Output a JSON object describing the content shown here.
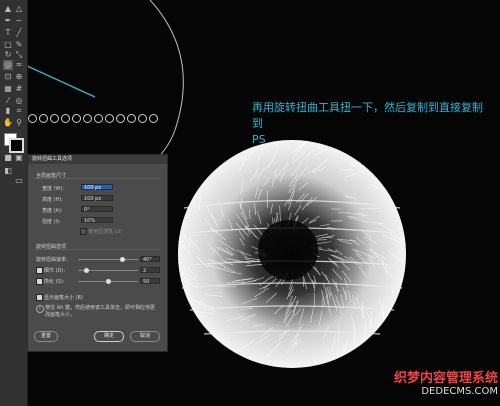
{
  "instruction": {
    "line1": "再用旋转扭曲工具扭一下，然后复制到直接复制到",
    "line2": "PS"
  },
  "dialog": {
    "title": "旋转扭曲工具选项",
    "section_brush": "全局画笔尺寸",
    "width_label": "宽度 (W):",
    "width_value": "100 px",
    "height_label": "高度 (H):",
    "height_value": "100 px",
    "angle_label": "角度 (A):",
    "angle_value": "0°",
    "intensity_label": "强度 (I):",
    "intensity_value": "10%",
    "pressure_label": "使用压感笔 (U)",
    "section_twirl": "旋转扭曲选项",
    "rate_label": "旋转扭曲速率:",
    "rate_value": "40°",
    "detail_label": "细节 (D):",
    "detail_value": "2",
    "simplify_label": "简化 (S):",
    "simplify_value": "50",
    "show_brush_label": "显示画笔大小 (B)",
    "tip_text": "按住 Alt 键，然后使用该工具单击，即可相应地更改画笔大小。",
    "reset_button": "重置",
    "ok_button": "确定",
    "cancel_button": "取消"
  },
  "watermark": {
    "line1": "织梦内容管理系统",
    "line2": "DEDECMS.COM"
  },
  "colors": {
    "accent": "#2ab6d4",
    "canvas": "#050505",
    "dialog_bg": "#4b4b4b",
    "toolbar_bg": "#323232"
  },
  "icons": [
    "selection-tool-icon",
    "direct-selection-icon",
    "pen-tool-icon",
    "type-tool-icon",
    "line-tool-icon",
    "shape-tool-icon",
    "brush-tool-icon",
    "pencil-tool-icon",
    "rotate-tool-icon",
    "scale-tool-icon",
    "twirl-tool-icon",
    "width-tool-icon",
    "eyedropper-icon",
    "blend-tool-icon",
    "graph-tool-icon",
    "artboard-tool-icon",
    "hand-tool-icon",
    "zoom-tool-icon",
    "fill-swatch-icon",
    "stroke-swatch-icon"
  ]
}
